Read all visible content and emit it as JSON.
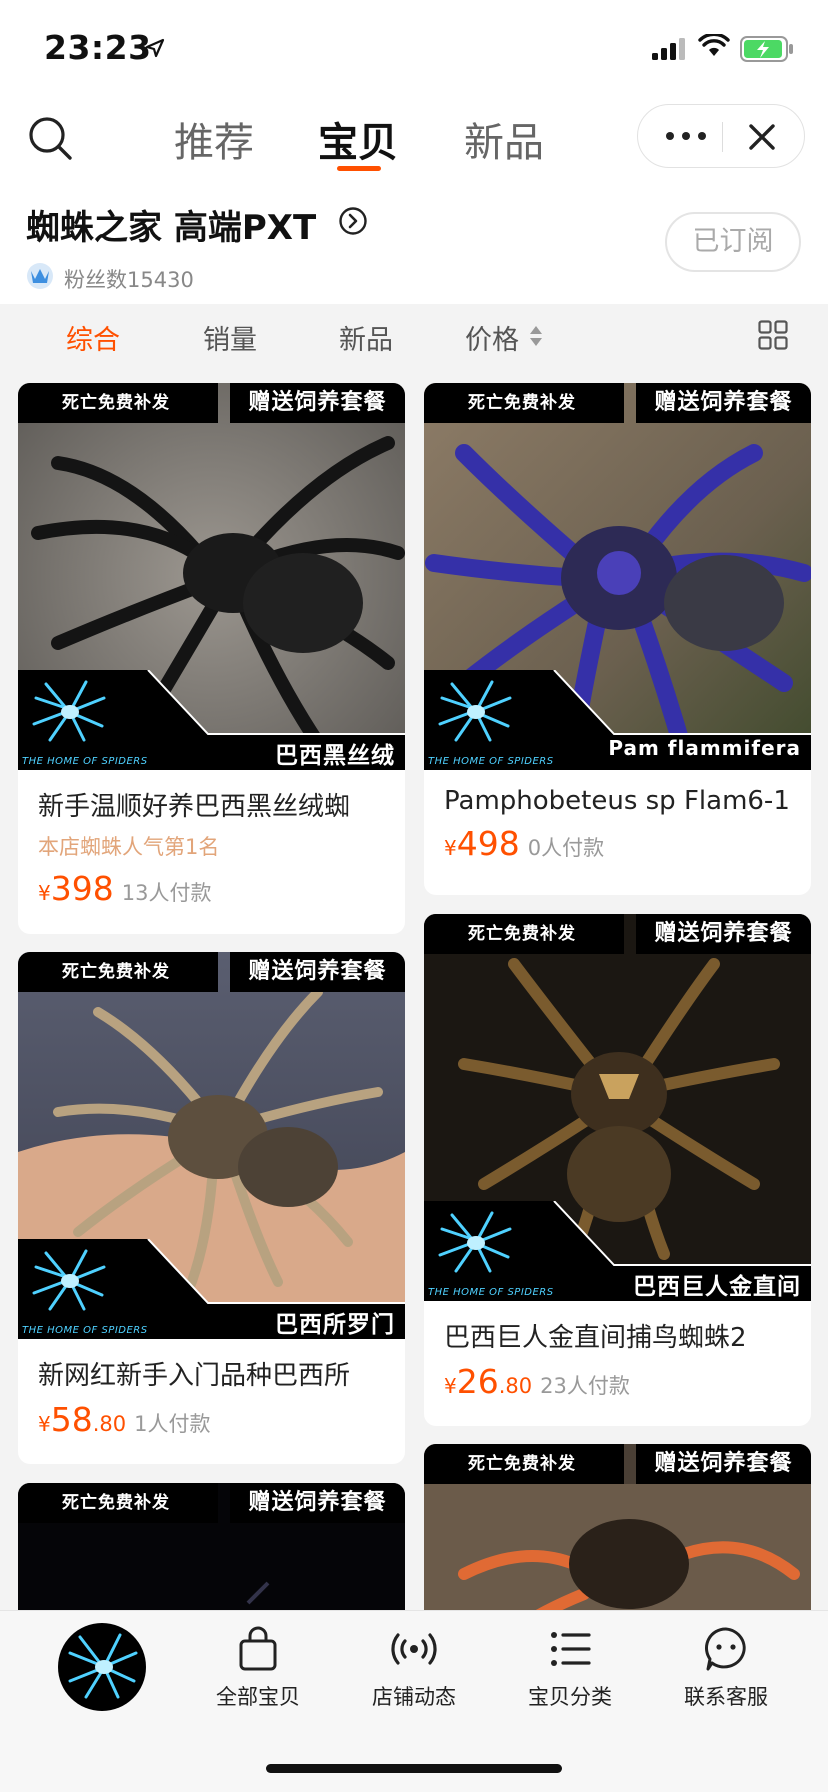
{
  "status_bar": {
    "time": "23:23"
  },
  "top_nav": {
    "tabs": [
      {
        "label": "推荐"
      },
      {
        "label": "宝贝"
      },
      {
        "label": "新品"
      }
    ],
    "active_tab": "宝贝"
  },
  "shop": {
    "name": "蜘蛛之家 高端PXT",
    "fans_label": "粉丝数15430",
    "subscribe_label": "已订阅"
  },
  "sort_bar": {
    "items": [
      {
        "label": "综合"
      },
      {
        "label": "销量"
      },
      {
        "label": "新品"
      },
      {
        "label": "价格"
      }
    ],
    "active": "综合"
  },
  "products": [
    {
      "banner_left": "死亡免费补发",
      "banner_right": "赠送饲养套餐",
      "image_label": "巴西黑丝绒",
      "logo_text": "THE HOME OF SPIDERS",
      "title": "新手温顺好养巴西黑丝绒蜘",
      "tagline": "本店蜘蛛人气第1名",
      "yen": "¥",
      "price_int": "398",
      "price_dec": "",
      "buyers": "13人付款"
    },
    {
      "banner_left": "死亡免费补发",
      "banner_right": "赠送饲养套餐",
      "image_label": "Pam flammifera",
      "logo_text": "THE HOME OF SPIDERS",
      "title": "Pamphobeteus sp Flam6-1",
      "tagline": "",
      "yen": "¥",
      "price_int": "498",
      "price_dec": "",
      "buyers": "0人付款"
    },
    {
      "banner_left": "死亡免费补发",
      "banner_right": "赠送饲养套餐",
      "image_label": "巴西所罗门",
      "logo_text": "THE HOME OF SPIDERS",
      "title": "新网红新手入门品种巴西所",
      "tagline": "",
      "yen": "¥",
      "price_int": "58",
      "price_dec": ".80",
      "buyers": "1人付款"
    },
    {
      "banner_left": "死亡免费补发",
      "banner_right": "赠送饲养套餐",
      "image_label": "巴西巨人金直间",
      "logo_text": "THE HOME OF SPIDERS",
      "title": "巴西巨人金直间捕鸟蜘蛛2",
      "tagline": "",
      "yen": "¥",
      "price_int": "26",
      "price_dec": ".80",
      "buyers": "23人付款"
    },
    {
      "banner_left": "死亡免费补发",
      "banner_right": "赠送饲养套餐"
    },
    {
      "banner_left": "死亡免费补发",
      "banner_right": "赠送饲养套餐"
    }
  ],
  "bottom_tabs": [
    {
      "label": "全部宝贝",
      "icon": "bag-icon"
    },
    {
      "label": "店铺动态",
      "icon": "broadcast-icon"
    },
    {
      "label": "宝贝分类",
      "icon": "list-icon"
    },
    {
      "label": "联系客服",
      "icon": "chat-bubble-icon"
    }
  ],
  "colors": {
    "accent": "#ff5000",
    "tagline": "#e2a57a"
  }
}
